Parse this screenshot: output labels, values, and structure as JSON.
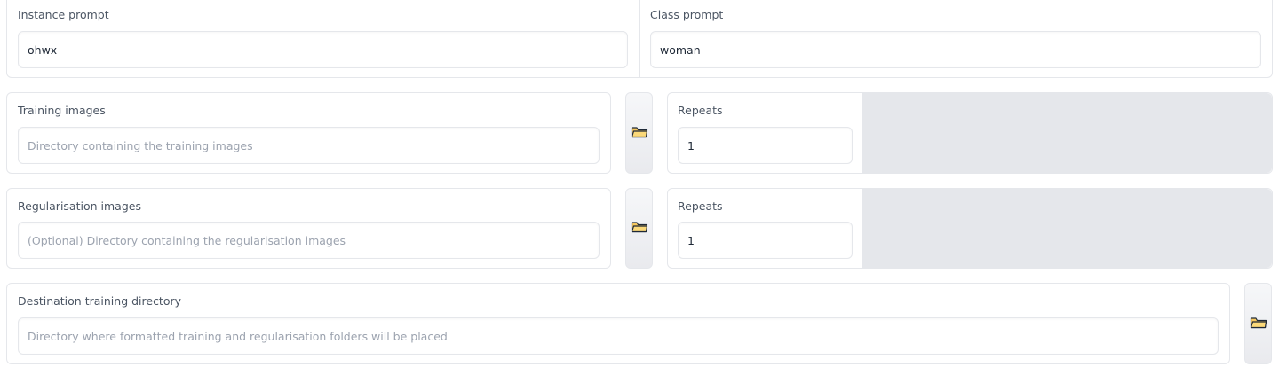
{
  "prompts": {
    "instance": {
      "label": "Instance prompt",
      "value": "ohwx"
    },
    "class": {
      "label": "Class prompt",
      "value": "woman"
    }
  },
  "training": {
    "label": "Training images",
    "placeholder": "Directory containing the training images",
    "value": "",
    "folder_icon": "folder-icon",
    "repeats_label": "Repeats",
    "repeats_value": "1"
  },
  "regularisation": {
    "label": "Regularisation images",
    "placeholder": "(Optional) Directory containing the regularisation images",
    "value": "",
    "folder_icon": "folder-icon",
    "repeats_label": "Repeats",
    "repeats_value": "1"
  },
  "destination": {
    "label": "Destination training directory",
    "placeholder": "Directory where formatted training and regularisation folders will be placed",
    "value": "",
    "folder_icon": "folder-icon"
  },
  "colors": {
    "folder_fill": "#f6c85f",
    "folder_stroke": "#1f2937",
    "panel_border": "#e5e7eb",
    "empty_pad": "#e5e7eb"
  }
}
